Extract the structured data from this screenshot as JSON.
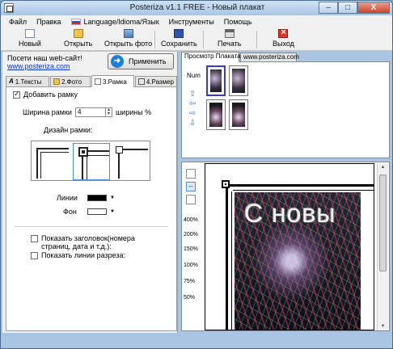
{
  "window": {
    "title": "Posteriza v1.1 FREE - Новый плакат",
    "min_label": "–",
    "max_label": "□",
    "close_label": "X"
  },
  "menu": {
    "file": "Файл",
    "edit": "Правка",
    "language": "Language/Idioma/Язык",
    "tools": "Инструменты",
    "help": "Помощь"
  },
  "toolbar": {
    "new": "Новый",
    "open": "Открыть",
    "open_photo": "Открыть фото",
    "save": "Сохранить",
    "print": "Печать",
    "exit": "Выход"
  },
  "left": {
    "visit_text": "Посети наш web-сайт!",
    "visit_link": "www.posteriza.com",
    "apply": "Применить",
    "tabs": [
      "1.Тексты",
      "2.Фото",
      "3.Рамка",
      "4.Размер"
    ],
    "add_frame": "Добавить рамку",
    "add_frame_checked": true,
    "frame_width_label": "Ширина рамки",
    "frame_width_value": "4",
    "frame_width_suffix": "ширины %",
    "frame_design_label": "Дизайн рамки:",
    "lines_label": "Линии",
    "background_label": "Фон",
    "lines_color": "#000000",
    "background_color": "#ffffff",
    "show_header": "Показать заголовок(номера страниц, дата и т.д.):",
    "show_cut_lines": "Показать линии разреза:"
  },
  "right": {
    "tabs": [
      "Просмотр Плаката",
      "www.posteriza.com"
    ],
    "num_label": "Num",
    "zoom_levels": [
      "400%",
      "200%",
      "150%",
      "100%",
      "75%",
      "50%"
    ],
    "poster_text": "С новы"
  }
}
